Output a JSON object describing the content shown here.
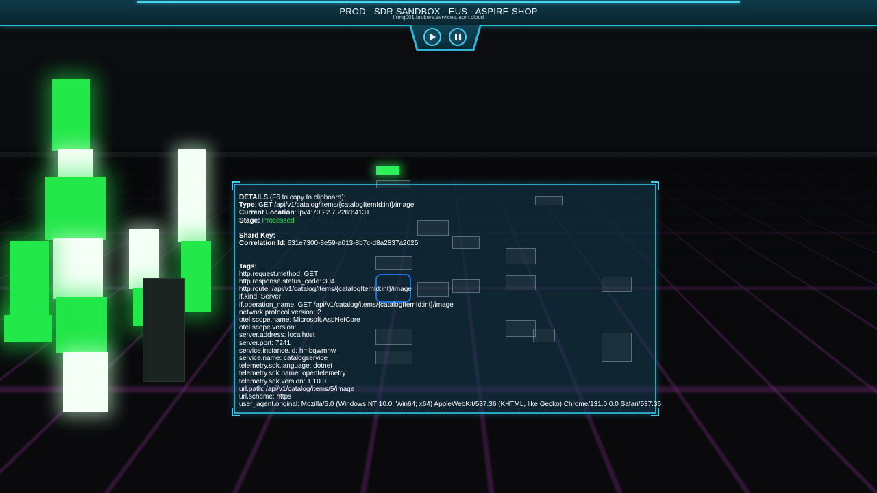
{
  "header": {
    "title": "PROD - SDR SANDBOX - EUS - ASPIRE-SHOP",
    "subtitle": "ifrmq001.brokers.services.iapm.cloud"
  },
  "controls": {
    "play_icon": "play-icon",
    "pause_icon": "pause-icon"
  },
  "details": {
    "heading": "DETAILS",
    "heading_hint": " (F6 to copy to clipboard):",
    "type_label": "Type",
    "type_value": ": GET /api/v1/catalog/items/{catalogItemId:int}/image",
    "location_label": "Current Location",
    "location_value": ":  ipv4:70.22.7.226:64131",
    "stage_label": "Stage",
    "stage_value": "Processed",
    "shard_label": "Shard Key",
    "correlation_label": "Correlation Id",
    "correlation_value": ": 631e7300-8e59-a013-8b7c-d8a2837a2025",
    "tags_label": "Tags",
    "tags": [
      "http.request.method: GET",
      "http.response.status_code: 304",
      "http.route: /api/v1/catalog/items/{catalogItemId:int}/image",
      "if.kind: Server",
      "if.operation_name: GET /api/v1/catalog/items/{catalogItemId:int}/image",
      "network.protocol.version: 2",
      "otel.scope.name: Microsoft.AspNetCore",
      "otel.scope.version:",
      "server.address: localhost",
      "server.port: 7241",
      "service.instance.id: hmbqwmhw",
      "service.name: catalogservice",
      "telemetry.sdk.language: dotnet",
      "telemetry.sdk.name: opentelemetry",
      "telemetry.sdk.version: 1.10.0",
      "url.path: /api/v1/catalog/items/5/image",
      "url.scheme: https",
      "user_agent.original: Mozilla/5.0 (Windows NT 10.0; Win64; x64) AppleWebKit/537.36 (KHTML, like Gecko) Chrome/131.0.0.0 Safari/537.36"
    ]
  },
  "colors": {
    "accent": "#2fb8d6",
    "processed": "#2ee65a",
    "block_green": "#23e84a"
  }
}
